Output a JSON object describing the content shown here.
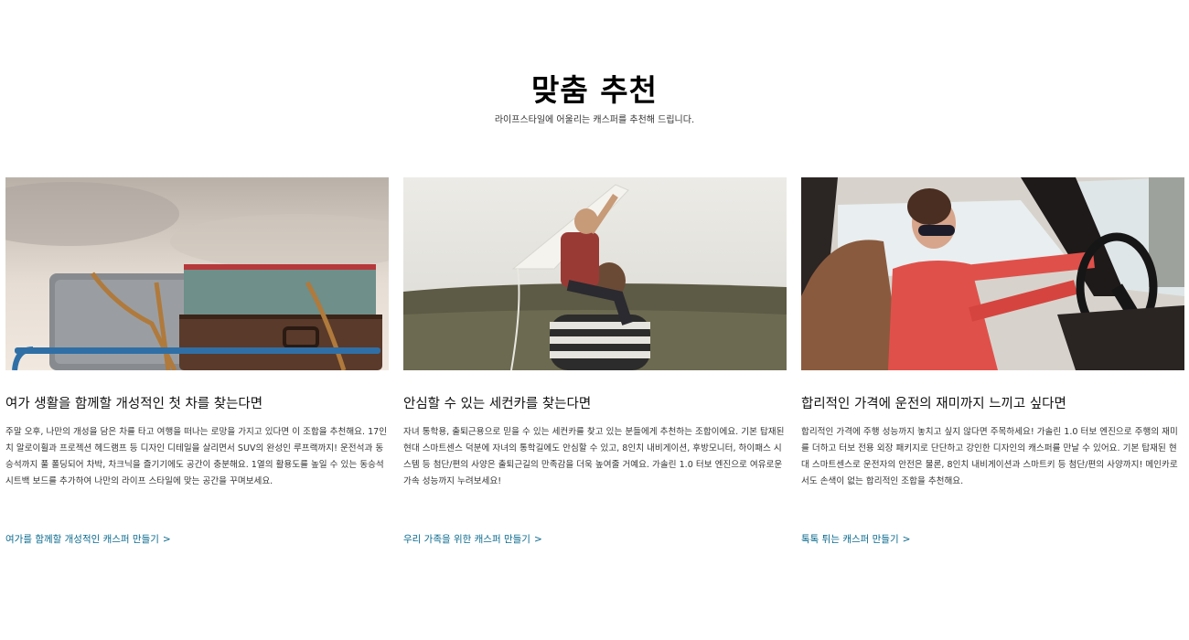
{
  "section": {
    "title": "맞춤 추천",
    "subtitle": "라이프스타일에 어울리는 캐스퍼를 추천해 드립니다."
  },
  "cards": [
    {
      "title": "여가 생활을 함께할 개성적인 첫 차를 찾는다면",
      "description": "주말 오후, 나만의 개성을 담은 차를 타고 여행을 떠나는 로망을 가지고 있다면 이 조합을 추천해요. 17인치 알로이휠과 프로젝션 헤드램프 등 디자인 디테일을 살리면서 SUV의 완성인 루프랙까지! 운전석과 동승석까지 풀 폴딩되어 차박, 차크닉을 즐기기에도 공간이 충분해요. 1열의 활용도를 높일 수 있는 동승석 시트백 보드를 추가하여 나만의 라이프 스타일에 맞는 공간을 꾸며보세요.",
      "link": "여가를 함께할 개성적인 캐스퍼 만들기",
      "image_icon": "luggage-photo"
    },
    {
      "title": "안심할 수 있는 세컨카를 찾는다면",
      "description": "자녀 통학용, 출퇴근용으로 믿을 수 있는 세컨카를 찾고 있는 분들에게 추천하는 조합이에요. 기본 탑재된 현대 스마트센스 덕분에 자녀의 통학길에도 안심할 수 있고, 8인치 내비게이션, 후방모니터, 하이패스 시스템 등 첨단/편의 사양은 출퇴근길의 만족감을 더욱 높여줄 거예요. 가솔린 1.0 터보 엔진으로 여유로운 가속 성능까지 누려보세요!",
      "link": "우리 가족을 위한 캐스퍼 만들기",
      "image_icon": "kite-family-photo"
    },
    {
      "title": "합리적인 가격에 운전의 재미까지 느끼고 싶다면",
      "description": "합리적인 가격에 주행 성능까지 놓치고 싶지 않다면 주목하세요! 가솔린 1.0 터보 엔진으로 주행의 재미를 더하고 터보 전용 외장 패키지로 단단하고 강인한 디자인의 캐스퍼를 만날 수 있어요. 기본 탑재된 현대 스마트센스로 운전자의 안전은 물론, 8인치 내비게이션과 스마트키 등 첨단/편의 사양까지! 메인카로서도 손색이 없는 합리적인 조합을 추천해요.",
      "link": "톡톡 튀는 캐스퍼 만들기",
      "image_icon": "driver-photo"
    }
  ],
  "chevron": ">",
  "colors": {
    "link": "#0a6a8e",
    "text": "#111111"
  }
}
